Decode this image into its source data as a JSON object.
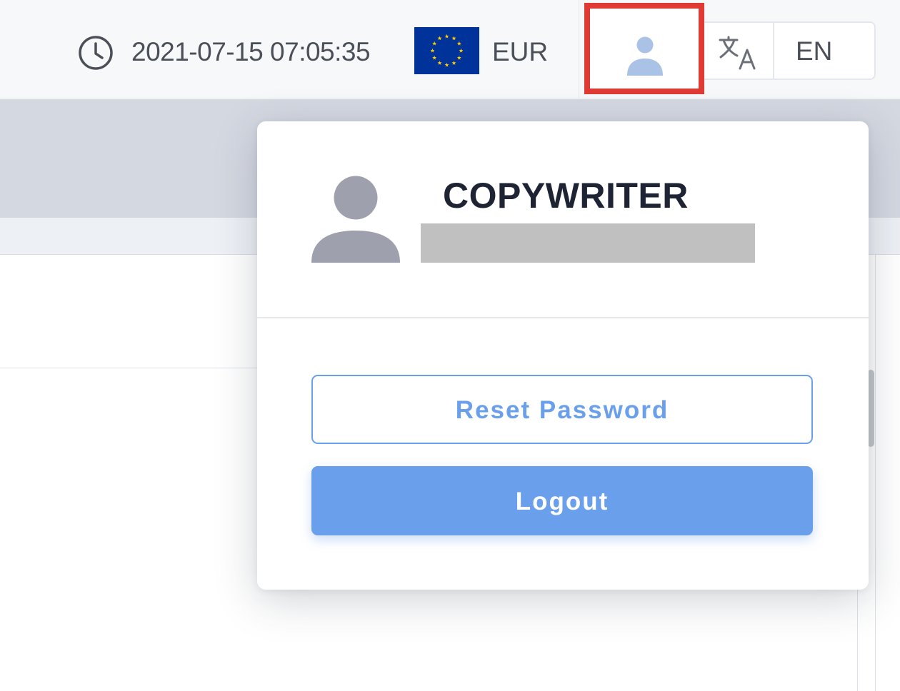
{
  "header": {
    "datetime": "2021-07-15 07:05:35",
    "currency": "EUR",
    "language": "EN",
    "icons": {
      "clock": "clock-icon",
      "flag": "eu-flag-icon",
      "user": "user-icon",
      "translate": "translate-icon"
    }
  },
  "user_menu": {
    "role": "COPYWRITER",
    "reset_password_label": "Reset Password",
    "logout_label": "Logout"
  },
  "colors": {
    "accent": "#6a9fec",
    "highlight": "#e03a35",
    "eu_blue": "#003399",
    "eu_gold": "#ffcc00"
  }
}
